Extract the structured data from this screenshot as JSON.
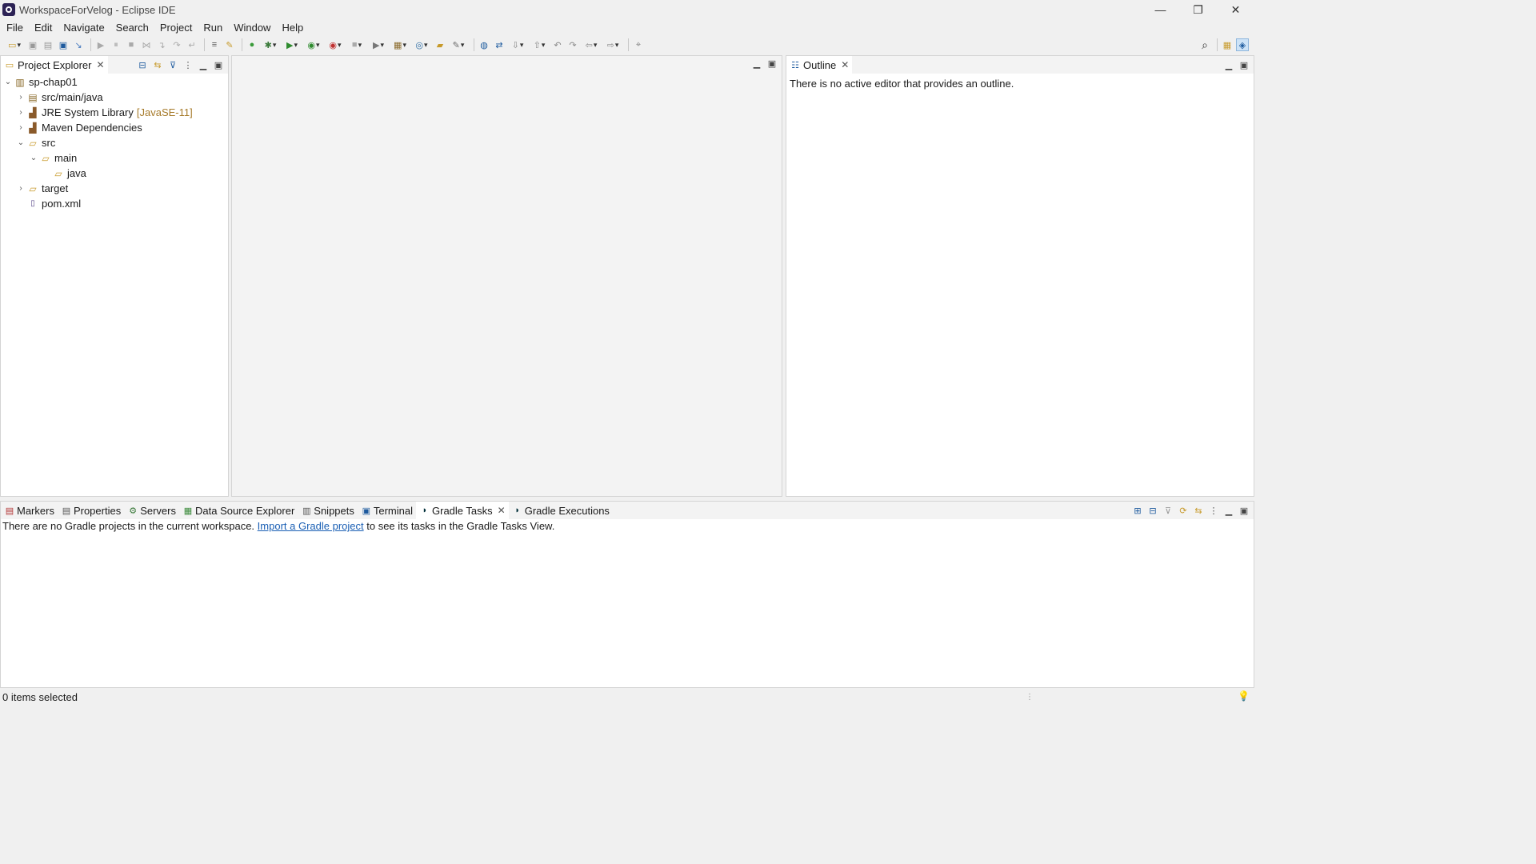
{
  "window": {
    "title": "WorkspaceForVelog - Eclipse IDE",
    "minimize": "—",
    "restore": "❐",
    "close": "✕"
  },
  "menu": [
    "File",
    "Edit",
    "Navigate",
    "Search",
    "Project",
    "Run",
    "Window",
    "Help"
  ],
  "project_explorer": {
    "tab_label": "Project Explorer",
    "tree": [
      {
        "label": "sp-chap01",
        "icon": "project-icon"
      },
      {
        "label": "src/main/java",
        "icon": "source-folder-icon"
      },
      {
        "label": "JRE System Library",
        "decoration": "[JavaSE-11]",
        "icon": "library-icon"
      },
      {
        "label": "Maven Dependencies",
        "icon": "library-icon"
      },
      {
        "label": "src",
        "icon": "folder-icon"
      },
      {
        "label": "main",
        "icon": "folder-icon"
      },
      {
        "label": "java",
        "icon": "folder-icon"
      },
      {
        "label": "target",
        "icon": "folder-icon"
      },
      {
        "label": "pom.xml",
        "icon": "xml-file-icon"
      }
    ]
  },
  "outline": {
    "tab_label": "Outline",
    "message": "There is no active editor that provides an outline."
  },
  "bottom": {
    "tabs": [
      "Markers",
      "Properties",
      "Servers",
      "Data Source Explorer",
      "Snippets",
      "Terminal",
      "Gradle Tasks",
      "Gradle Executions"
    ],
    "active_tab": "Gradle Tasks",
    "message_before": "There are no Gradle projects in the current workspace.",
    "link": "Import a Gradle project",
    "message_after": "to see its tasks in the Gradle Tasks View."
  },
  "status": {
    "text": "0 items selected"
  },
  "colors": {
    "link": "#1a5fb4",
    "folder": "#c79a2b"
  }
}
